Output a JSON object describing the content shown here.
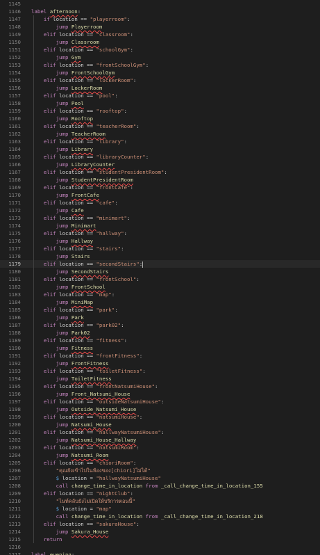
{
  "editor": {
    "current_line": 1179,
    "lines": [
      {
        "n": "1145",
        "code": ""
      },
      {
        "n": "1146",
        "code": "label afternoon:"
      },
      {
        "n": "1147",
        "code": "    if location == \"playerroom\":"
      },
      {
        "n": "1148",
        "code": "        jump Playerroom"
      },
      {
        "n": "1149",
        "code": "    elif location == \"classroom\":"
      },
      {
        "n": "1150",
        "code": "        jump Classroom"
      },
      {
        "n": "1151",
        "code": "    elif location == \"schoolGym\":"
      },
      {
        "n": "1152",
        "code": "        jump Gym"
      },
      {
        "n": "1153",
        "code": "    elif location == \"frontSchoolGym\":"
      },
      {
        "n": "1154",
        "code": "        jump FrontSchoolGym"
      },
      {
        "n": "1155",
        "code": "    elif location == \"lockerRoom\":"
      },
      {
        "n": "1156",
        "code": "        jump LockerRoom"
      },
      {
        "n": "1157",
        "code": "    elif location == \"pool\":"
      },
      {
        "n": "1158",
        "code": "        jump Pool"
      },
      {
        "n": "1159",
        "code": "    elif location == \"rooftop\":"
      },
      {
        "n": "1160",
        "code": "        jump Rooftop"
      },
      {
        "n": "1161",
        "code": "    elif location == \"teacherRoom\":"
      },
      {
        "n": "1162",
        "code": "        jump TeacherRoom"
      },
      {
        "n": "1163",
        "code": "    elif location == \"library\":"
      },
      {
        "n": "1164",
        "code": "        jump Library"
      },
      {
        "n": "1165",
        "code": "    elif location == \"libraryCounter\":"
      },
      {
        "n": "1166",
        "code": "        jump LibraryCounter"
      },
      {
        "n": "1167",
        "code": "    elif location == \"studentPresidentRoom\":"
      },
      {
        "n": "1168",
        "code": "        jump StudentPresidentRoom"
      },
      {
        "n": "1169",
        "code": "    elif location == \"frontCafe\":"
      },
      {
        "n": "1170",
        "code": "        jump FrontCafe"
      },
      {
        "n": "1171",
        "code": "    elif location == \"cafe\":"
      },
      {
        "n": "1172",
        "code": "        jump Cafe"
      },
      {
        "n": "1173",
        "code": "    elif location == \"minimart\":"
      },
      {
        "n": "1174",
        "code": "        jump Minimart"
      },
      {
        "n": "1175",
        "code": "    elif location == \"hallway\":"
      },
      {
        "n": "1176",
        "code": "        jump Hallway"
      },
      {
        "n": "1177",
        "code": "    elif location == \"stairs\":"
      },
      {
        "n": "1178",
        "code": "        jump Stairs"
      },
      {
        "n": "1179",
        "code": "    elif location == \"secondStairs\":"
      },
      {
        "n": "1180",
        "code": "        jump SecondStairs"
      },
      {
        "n": "1181",
        "code": "    elif location == \"frontSchool\":"
      },
      {
        "n": "1182",
        "code": "        jump FrontSchool"
      },
      {
        "n": "1183",
        "code": "    elif location == \"map\":"
      },
      {
        "n": "1184",
        "code": "        jump MiniMap"
      },
      {
        "n": "1185",
        "code": "    elif location == \"park\":"
      },
      {
        "n": "1186",
        "code": "        jump Park"
      },
      {
        "n": "1187",
        "code": "    elif location == \"park02\":"
      },
      {
        "n": "1188",
        "code": "        jump Park02"
      },
      {
        "n": "1189",
        "code": "    elif location == \"fitness\":"
      },
      {
        "n": "1190",
        "code": "        jump Fitness"
      },
      {
        "n": "1191",
        "code": "    elif location == \"frontFitness\":"
      },
      {
        "n": "1192",
        "code": "        jump FrontFitness"
      },
      {
        "n": "1193",
        "code": "    elif location == \"toiletFitness\":"
      },
      {
        "n": "1194",
        "code": "        jump ToiletFitness"
      },
      {
        "n": "1195",
        "code": "    elif location == \"frontNatsumiHouse\":"
      },
      {
        "n": "1196",
        "code": "        jump Front_Natsumi_House"
      },
      {
        "n": "1197",
        "code": "    elif location == \"outsideNatsumiHouse\":"
      },
      {
        "n": "1198",
        "code": "        jump Outside_Natsumi_House"
      },
      {
        "n": "1199",
        "code": "    elif location == \"natsumiHouse\":"
      },
      {
        "n": "1200",
        "code": "        jump Natsumi_House"
      },
      {
        "n": "1201",
        "code": "    elif location == \"hallwayNatsumiHouse\":"
      },
      {
        "n": "1202",
        "code": "        jump Natsumi_House_Hallway"
      },
      {
        "n": "1203",
        "code": "    elif location == \"natsumiRoom\":"
      },
      {
        "n": "1204",
        "code": "        jump Natsumi_Room"
      },
      {
        "n": "1205",
        "code": "    elif location == \"chioriRoom\":"
      },
      {
        "n": "1206",
        "code": "        \"คุณยังเข้าไปในห้องของ[chiori]ไม่ได้\""
      },
      {
        "n": "1207",
        "code": "        $ location = \"hallwayNatsumiHouse\""
      },
      {
        "n": "1208",
        "code": "        call change_time_in_location from _call_change_time_in_location_155"
      },
      {
        "n": "1209",
        "code": "    elif location == \"nightClub\":"
      },
      {
        "n": "1210",
        "code": "        \"ไนท์คลับยังไม่เปิดให้บริการตอนนี้\""
      },
      {
        "n": "1211",
        "code": "        $ location = \"map\""
      },
      {
        "n": "1212",
        "code": "        call change_time_in_location from _call_change_time_in_location_218"
      },
      {
        "n": "1213",
        "code": "    elif location == \"sakuraHouse\":"
      },
      {
        "n": "1214",
        "code": "        jump Sakura_House"
      },
      {
        "n": "1215",
        "code": "    return"
      },
      {
        "n": "1216",
        "code": ""
      },
      {
        "n": "1217",
        "code": "label evening:"
      }
    ]
  }
}
